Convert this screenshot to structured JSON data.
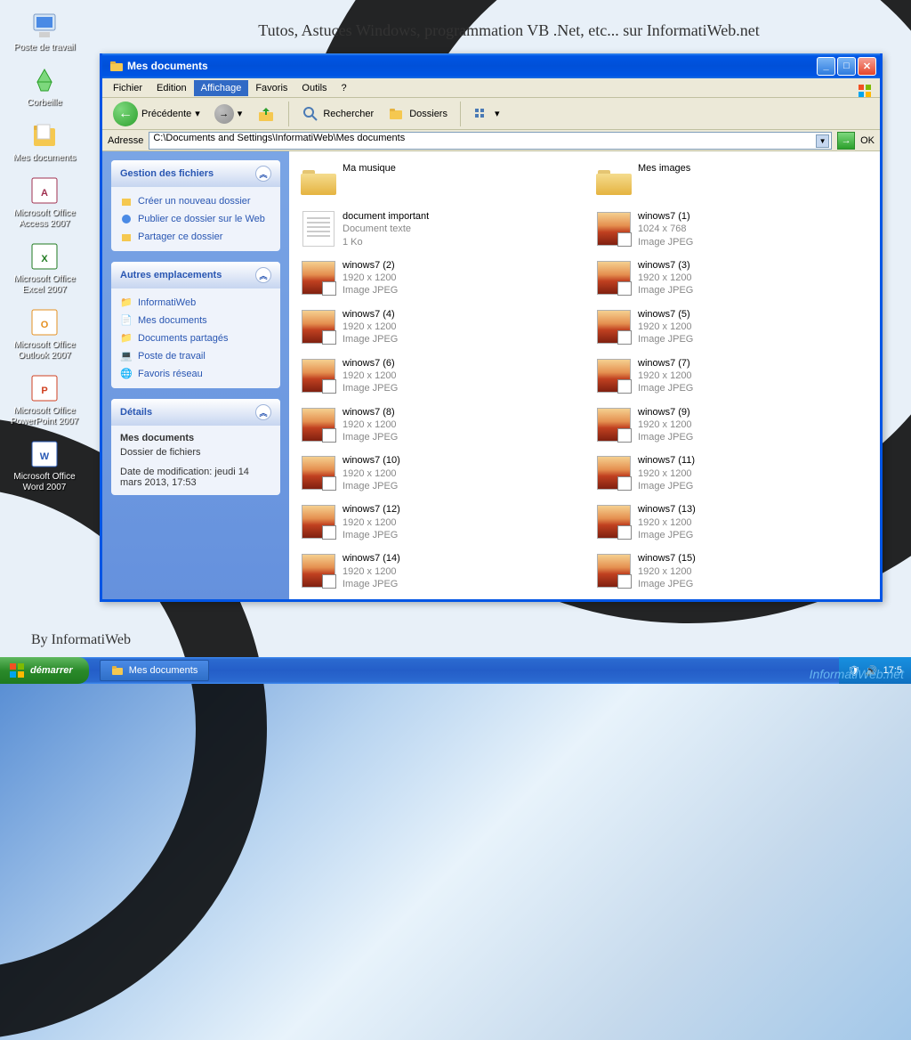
{
  "banner_text": "Tutos, Astuces Windows, programmation VB .Net, etc... sur InformatiWeb.net",
  "credit_text": "By InformatiWeb",
  "watermark": "InformatiWeb.net",
  "desktop": {
    "icons": [
      {
        "label": "Poste de travail",
        "icon": "computer"
      },
      {
        "label": "Corbeille",
        "icon": "recycle"
      },
      {
        "label": "Mes documents",
        "icon": "mydocs"
      },
      {
        "label": "Microsoft Office Access 2007",
        "icon": "access"
      },
      {
        "label": "Microsoft Office Excel 2007",
        "icon": "excel"
      },
      {
        "label": "Microsoft Office Outlook 2007",
        "icon": "outlook"
      },
      {
        "label": "Microsoft Office PowerPoint 2007",
        "icon": "powerpoint"
      },
      {
        "label": "Microsoft Office Word 2007",
        "icon": "word"
      }
    ]
  },
  "window": {
    "title": "Mes documents",
    "menu": {
      "items": [
        "Fichier",
        "Edition",
        "Affichage",
        "Favoris",
        "Outils",
        "?"
      ],
      "active": "Affichage"
    },
    "toolbar": {
      "back": "Précédente",
      "search": "Rechercher",
      "folders": "Dossiers"
    },
    "address": {
      "label": "Adresse",
      "path": "C:\\Documents and Settings\\InformatiWeb\\Mes documents",
      "go": "OK"
    },
    "sidebar": {
      "p1_title": "Gestion des fichiers",
      "p1_items": [
        "Créer un nouveau dossier",
        "Publier ce dossier sur le Web",
        "Partager ce dossier"
      ],
      "p2_title": "Autres emplacements",
      "p2_items": [
        "InformatiWeb",
        "Mes documents",
        "Documents partagés",
        "Poste de travail",
        "Favoris réseau"
      ],
      "p3_title": "Détails",
      "p3_name": "Mes documents",
      "p3_type": "Dossier de fichiers",
      "p3_date": "Date de modification: jeudi 14 mars 2013, 17:53"
    },
    "files": [
      {
        "name": "Ma musique",
        "type": "folder"
      },
      {
        "name": "Mes images",
        "type": "folder"
      },
      {
        "name": "document important",
        "l2": "Document texte",
        "l3": "1 Ko",
        "type": "txt"
      },
      {
        "name": "winows7 (1)",
        "l2": "1024 x 768",
        "l3": "Image JPEG",
        "type": "img"
      },
      {
        "name": "winows7 (2)",
        "l2": "1920 x 1200",
        "l3": "Image JPEG",
        "type": "img"
      },
      {
        "name": "winows7 (3)",
        "l2": "1920 x 1200",
        "l3": "Image JPEG",
        "type": "img"
      },
      {
        "name": "winows7 (4)",
        "l2": "1920 x 1200",
        "l3": "Image JPEG",
        "type": "img"
      },
      {
        "name": "winows7 (5)",
        "l2": "1920 x 1200",
        "l3": "Image JPEG",
        "type": "img"
      },
      {
        "name": "winows7 (6)",
        "l2": "1920 x 1200",
        "l3": "Image JPEG",
        "type": "img"
      },
      {
        "name": "winows7 (7)",
        "l2": "1920 x 1200",
        "l3": "Image JPEG",
        "type": "img"
      },
      {
        "name": "winows7 (8)",
        "l2": "1920 x 1200",
        "l3": "Image JPEG",
        "type": "img"
      },
      {
        "name": "winows7 (9)",
        "l2": "1920 x 1200",
        "l3": "Image JPEG",
        "type": "img"
      },
      {
        "name": "winows7 (10)",
        "l2": "1920 x 1200",
        "l3": "Image JPEG",
        "type": "img"
      },
      {
        "name": "winows7 (11)",
        "l2": "1920 x 1200",
        "l3": "Image JPEG",
        "type": "img"
      },
      {
        "name": "winows7 (12)",
        "l2": "1920 x 1200",
        "l3": "Image JPEG",
        "type": "img"
      },
      {
        "name": "winows7 (13)",
        "l2": "1920 x 1200",
        "l3": "Image JPEG",
        "type": "img"
      },
      {
        "name": "winows7 (14)",
        "l2": "1920 x 1200",
        "l3": "Image JPEG",
        "type": "img"
      },
      {
        "name": "winows7 (15)",
        "l2": "1920 x 1200",
        "l3": "Image JPEG",
        "type": "img"
      }
    ]
  },
  "taskbar": {
    "start": "démarrer",
    "task1": "Mes documents",
    "time": "17:5"
  }
}
